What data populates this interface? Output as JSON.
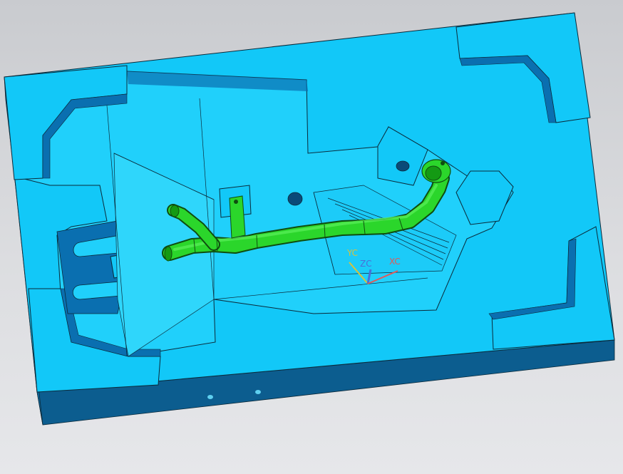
{
  "viewport": {
    "background_top": "#c9cbcf",
    "background_bottom": "#e6e7ea"
  },
  "colors": {
    "mold_face": "#12c8f8",
    "mold_cavity": "#20d0fb",
    "mold_side": "#0c5d8f",
    "mold_wall_shadow": "#0a6fb0",
    "edge_line": "#0b2a3a",
    "part_green": "#2bd62b",
    "part_green_dark": "#149a14",
    "part_edge": "#0f4d0f",
    "axis_x": "#e05a5a",
    "axis_y": "#d8c23a",
    "axis_z": "#4a6fd8"
  },
  "wcs_triad": {
    "x_label": "XC",
    "y_label": "YC",
    "z_label": "ZC"
  }
}
